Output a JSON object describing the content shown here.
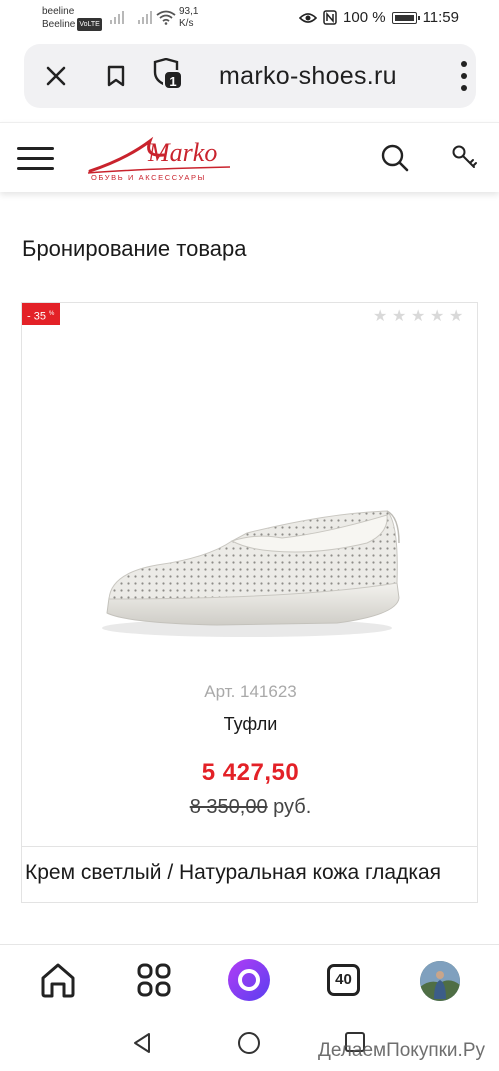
{
  "status_bar": {
    "carrier1": "beeline",
    "carrier2": "Beeline",
    "volte": "VoLTE",
    "speed_value": "93,1",
    "speed_unit": "K/s",
    "battery": "100 %",
    "time": "11:59"
  },
  "browser": {
    "url": "marko-shoes.ru",
    "tab_count_badge": "1"
  },
  "site": {
    "logo_text": "Marko",
    "logo_subtitle": "ОБУВЬ И АКСЕССУАРЫ",
    "page_title": "Бронирование товара"
  },
  "product": {
    "discount_badge": "- 35",
    "discount_unit": "%",
    "rating_stars": 0,
    "rating_max": 5,
    "article": "Арт. 141623",
    "name": "Туфли",
    "price": "5 427,50",
    "old_price": "8 350,00",
    "currency": "руб.",
    "variant": "Крем светлый / Натуральная кожа гладкая"
  },
  "bottom_nav": {
    "tabs_count": "40"
  },
  "watermark": "ДелаемПокупки.Ру",
  "colors": {
    "accent_red": "#e32127",
    "text": "#1a1a1a",
    "muted": "#a9a9a9",
    "alice_purple": "#7b3ff2"
  }
}
